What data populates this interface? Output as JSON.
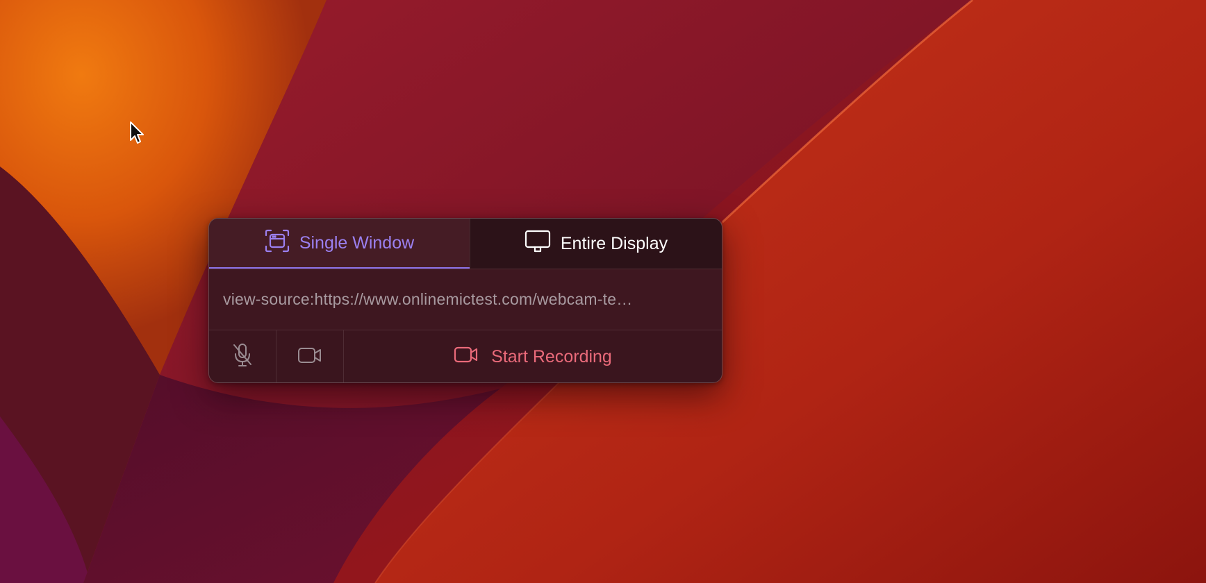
{
  "recorder": {
    "tabs": [
      {
        "label": "Single Window",
        "icon": "window-capture-icon",
        "selected": true
      },
      {
        "label": "Entire Display",
        "icon": "monitor-icon",
        "selected": false
      }
    ],
    "target_url": "view-source:https://www.onlinemictest.com/webcam-te…",
    "microphone": {
      "icon": "microphone-muted-icon",
      "enabled": false
    },
    "camera": {
      "icon": "video-camera-icon",
      "enabled": false
    },
    "start_label": "Start Recording",
    "start_icon": "video-camera-icon"
  },
  "colors": {
    "accent": "#9b80f0",
    "record": "#ea6a7a",
    "panel": "#3a161e"
  }
}
